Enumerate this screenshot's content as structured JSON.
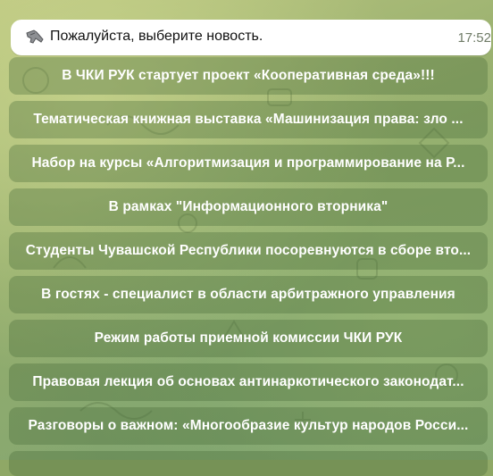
{
  "message": {
    "text": "Пожалуйста, выберите новость.",
    "time": "17:52",
    "icon": "pointing-hand-icon"
  },
  "keyboard": {
    "buttons": [
      {
        "label": "В ЧКИ РУК стартует проект «Кооперативная среда»!!!"
      },
      {
        "label": "Тематическая книжная выставка «Машинизация права: зло ..."
      },
      {
        "label": "Набор на курсы «Алгоритмизация и программирование на Р..."
      },
      {
        "label": "В рамках \"Информационного вторника\""
      },
      {
        "label": "Студенты Чувашской Республики посоревнуются в сборе вто..."
      },
      {
        "label": "В гостях - специалист в области арбитражного управления"
      },
      {
        "label": "Режим работы приемной комиссии ЧКИ РУК"
      },
      {
        "label": "Правовая лекция об основах антинаркотического законодат..."
      },
      {
        "label": "Разговоры о важном: «Многообразие культур народов Росси..."
      },
      {
        "label": ""
      }
    ]
  },
  "colors": {
    "button_bg": "#466937",
    "button_text": "#ffffff",
    "bubble_bg": "#ffffff",
    "time_text": "#6f7b67"
  }
}
